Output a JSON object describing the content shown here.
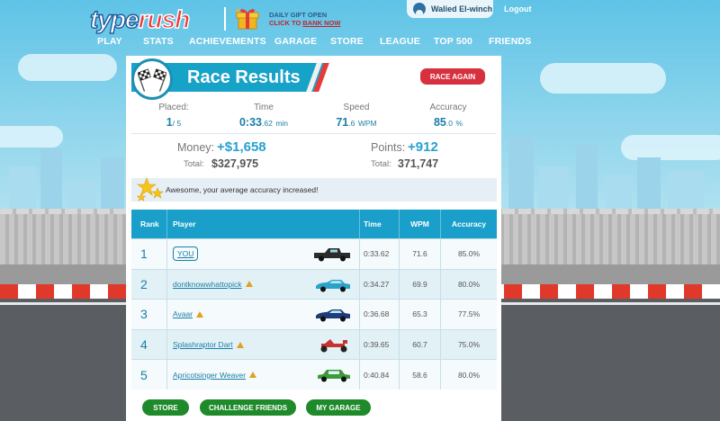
{
  "header": {
    "logo_type": "type",
    "logo_rush": "rush",
    "gift_line1": "DAILY GIFT OPEN",
    "gift_line2_prefix": "CLICK TO ",
    "gift_line2_link": "BANK NOW",
    "user_name": "Walied El-winch",
    "logout": "Logout"
  },
  "nav": [
    "PLAY",
    "STATS",
    "ACHIEVEMENTS",
    "GARAGE",
    "STORE",
    "LEAGUE",
    "TOP 500",
    "FRIENDS"
  ],
  "results": {
    "title": "Race Results",
    "race_again": "RACE AGAIN",
    "placed_label": "Placed:",
    "placed_value": "1",
    "placed_of": "/ 5",
    "time_label": "Time",
    "time_value": "0:33",
    "time_decimal": ".62",
    "time_unit": "min",
    "speed_label": "Speed",
    "speed_value": "71",
    "speed_decimal": ".6",
    "speed_unit": "WPM",
    "accuracy_label": "Accuracy",
    "accuracy_value": "85",
    "accuracy_decimal": ".0",
    "accuracy_unit": "%",
    "money_label": "Money:",
    "money_value": "+$1,658",
    "money_total_label": "Total:",
    "money_total": "$327,975",
    "points_label": "Points:",
    "points_value": "+912",
    "points_total_label": "Total:",
    "points_total": "371,747",
    "notice": "Awesome, your average accuracy increased!"
  },
  "table": {
    "headers": {
      "rank": "Rank",
      "player": "Player",
      "time": "Time",
      "wpm": "WPM",
      "accuracy": "Accuracy"
    },
    "rows": [
      {
        "rank": "1",
        "player": "YOU",
        "time": "0:33.62",
        "wpm": "71.6",
        "accuracy": "85.0%",
        "car_color": "#2b2b2b",
        "warn": false,
        "car_type": "truck"
      },
      {
        "rank": "2",
        "player": "dontknowwhattopick",
        "time": "0:34.27",
        "wpm": "69.9",
        "accuracy": "80.0%",
        "car_color": "#2aa3c8",
        "warn": true,
        "car_type": "sport"
      },
      {
        "rank": "3",
        "player": "Avaar",
        "time": "0:36.68",
        "wpm": "65.3",
        "accuracy": "77.5%",
        "car_color": "#1c3d7a",
        "warn": true,
        "car_type": "sport"
      },
      {
        "rank": "4",
        "player": "Splashraptor Dart",
        "time": "0:39.65",
        "wpm": "60.7",
        "accuracy": "75.0%",
        "car_color": "#c8322f",
        "warn": true,
        "car_type": "kart"
      },
      {
        "rank": "5",
        "player": "Apricotsinger Weaver",
        "time": "0:40.84",
        "wpm": "58.6",
        "accuracy": "80.0%",
        "car_color": "#3e9a3a",
        "warn": true,
        "car_type": "sedan"
      }
    ]
  },
  "buttons": {
    "store": "STORE",
    "challenge": "CHALLENGE FRIENDS",
    "garage": "MY GARAGE"
  },
  "colors": {
    "accent": "#17a2c8",
    "race_again": "#d7303f",
    "green_button": "#1e8a2a",
    "logo_red": "#e8393b"
  }
}
